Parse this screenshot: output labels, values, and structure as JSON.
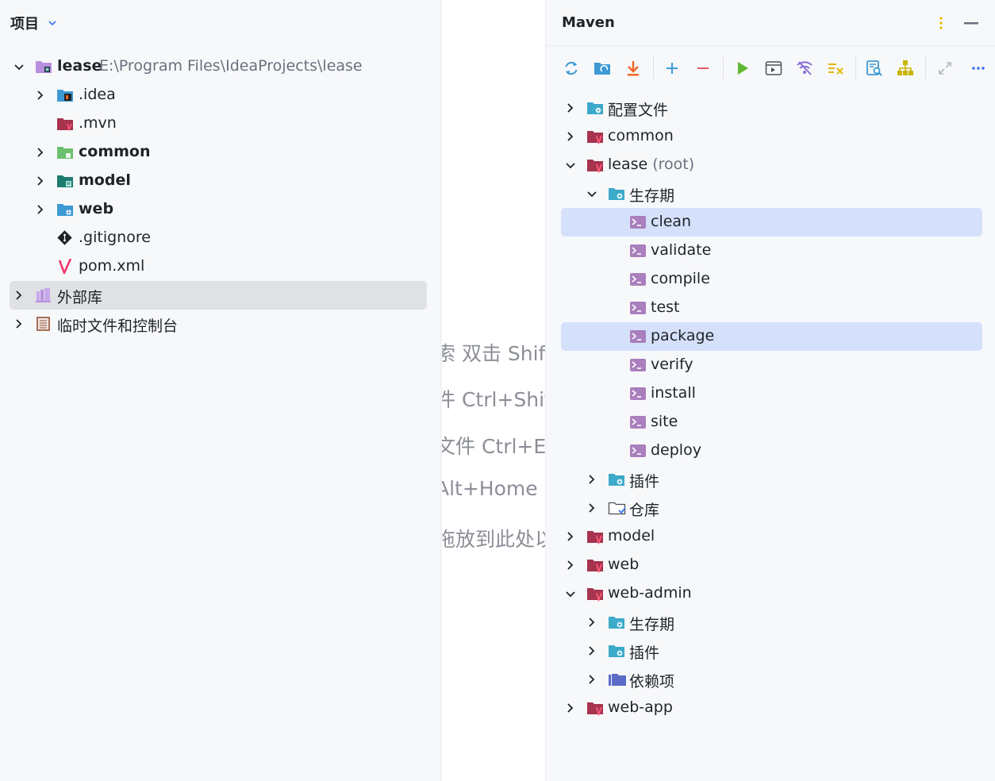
{
  "project": {
    "title": "项目",
    "tree": [
      {
        "label": "lease",
        "path": "E:\\Program Files\\IdeaProjects\\lease",
        "icon": "module-folder-icon",
        "expanded": true
      },
      {
        "label": ".idea",
        "icon": "idea-folder-icon"
      },
      {
        "label": ".mvn",
        "icon": "maven-folder-icon"
      },
      {
        "label": "common",
        "icon": "module-folder-icon"
      },
      {
        "label": "model",
        "icon": "module-folder-icon"
      },
      {
        "label": "web",
        "icon": "web-module-folder-icon"
      },
      {
        "label": ".gitignore",
        "icon": "git-icon"
      },
      {
        "label": "pom.xml",
        "icon": "maven-icon"
      },
      {
        "label": "外部库",
        "icon": "library-icon"
      },
      {
        "label": "临时文件和控制台",
        "icon": "scratches-icon"
      }
    ]
  },
  "editor_hints": [
    "索 双击 Shift",
    "件 Ctrl+Shift",
    "文件 Ctrl+E",
    "Alt+Home",
    "拖放到此处以"
  ],
  "maven": {
    "title": "Maven",
    "toolbar": [
      "reload-icon",
      "generate-sources-icon",
      "download-icon",
      "add-icon",
      "remove-icon",
      "run-icon",
      "execute-goal-icon",
      "offline-icon",
      "skip-tests-icon",
      "analyze-dependencies-icon",
      "show-dependencies-icon",
      "collapse-icon",
      "more-icon"
    ],
    "tree": [
      {
        "label": "配置文件"
      },
      {
        "label": "common"
      },
      {
        "label": "lease",
        "suffix": "(root)"
      },
      {
        "label": "生存期"
      },
      {
        "label": "clean"
      },
      {
        "label": "validate"
      },
      {
        "label": "compile"
      },
      {
        "label": "test"
      },
      {
        "label": "package"
      },
      {
        "label": "verify"
      },
      {
        "label": "install"
      },
      {
        "label": "site"
      },
      {
        "label": "deploy"
      },
      {
        "label": "插件"
      },
      {
        "label": "仓库"
      },
      {
        "label": "model"
      },
      {
        "label": "web"
      },
      {
        "label": "web-admin"
      },
      {
        "label": "生存期"
      },
      {
        "label": "插件"
      },
      {
        "label": "依赖项"
      },
      {
        "label": "web-app"
      }
    ]
  },
  "colors": {
    "accent": "#3574f0",
    "selection": "#d5e1fb",
    "maven_red": "#c93c5a",
    "goal_purple": "#9f6fb0",
    "folder_blue": "#3d9ad4"
  }
}
